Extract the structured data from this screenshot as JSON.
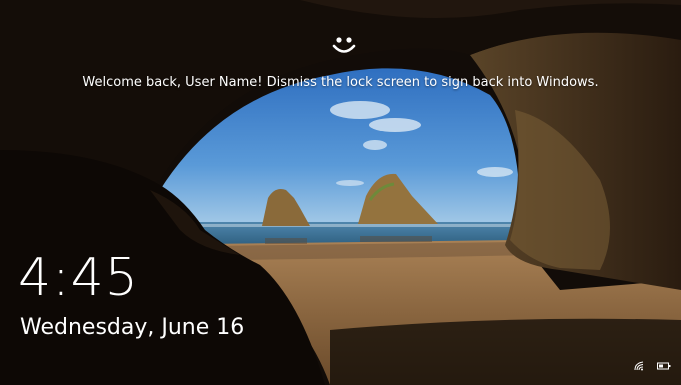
{
  "lock_screen": {
    "welcome_message": "Welcome back, User Name! Dismiss the lock screen to sign back into Windows.",
    "time": "4:45",
    "date": "Wednesday, June 16",
    "face_icon": "smiley-face-icon"
  },
  "system_tray": {
    "network_icon": "wifi-icon",
    "battery_icon": "battery-icon"
  },
  "colors": {
    "sky": "#3a78c4",
    "sand": "#b98a52",
    "cave": "#1a120c",
    "text": "#ffffff"
  }
}
